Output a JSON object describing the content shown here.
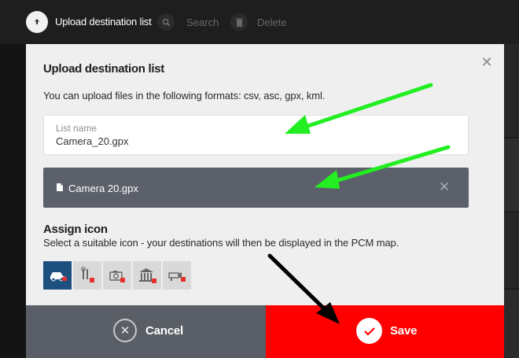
{
  "toolbar": {
    "title": "Upload destination list",
    "search_label": "Search",
    "delete_label": "Delete"
  },
  "dialog": {
    "title": "Upload destination list",
    "description": "You can upload files in the following formats: csv, asc, gpx, kml.",
    "list_name": {
      "label": "List name",
      "value": "Camera_20.gpx"
    },
    "uploaded_file": {
      "name": "Camera 20.gpx"
    },
    "assign_icon": {
      "title": "Assign icon",
      "description": "Select a suitable icon - your destinations will then be displayed in the PCM map.",
      "options": [
        {
          "icon": "car-icon",
          "selected": true
        },
        {
          "icon": "workshop-tools-icon",
          "selected": false
        },
        {
          "icon": "camera-icon",
          "selected": false
        },
        {
          "icon": "building-icon",
          "selected": false
        },
        {
          "icon": "speed-camera-icon",
          "selected": false
        }
      ]
    },
    "cancel_label": "Cancel",
    "save_label": "Save"
  },
  "colors": {
    "save": "#ff0000",
    "cancel": "#5a5e66",
    "file_bar": "#5b606a",
    "selected_icon": "#1d4f7f",
    "arrow_green": "#22ee22"
  }
}
